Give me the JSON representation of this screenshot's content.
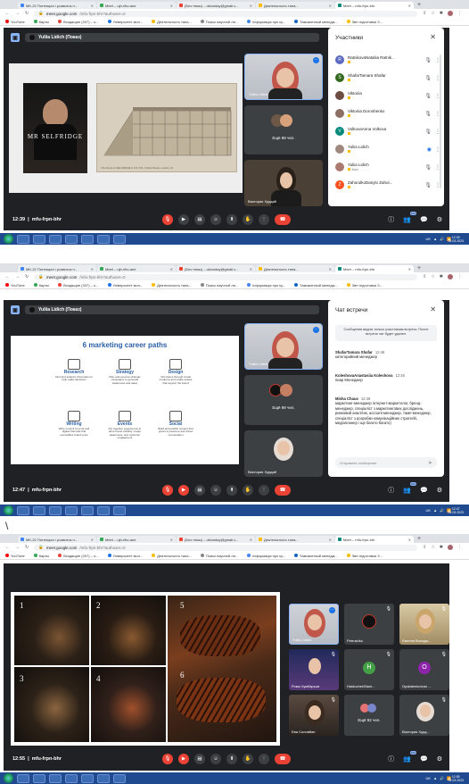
{
  "browser": {
    "tabs": [
      "MK-22 Потенціал і розвиток п...",
      "Meet – ujh-rfkv-ane",
      "(Без темы) – oklunday@gmail.c...",
      "Деятельность тана...",
      "Meet – mfu-frpn-bhr"
    ],
    "url_host": "meet.google.com",
    "url_path": "/mfu-frpn-bhr?authuser=0",
    "bookmarks": [
      "YouTube",
      "Карты",
      "Входящие (337) – о...",
      "Університет мол...",
      "Деятельность тана...",
      "Поиск научной ли...",
      "Інформація про ку...",
      "Таможенный менедж...",
      "Звіт підготовки З..."
    ]
  },
  "shot1": {
    "presenter": "Yuliia Lidich (Показ)",
    "slide_poster_title": "MR SELFRIDGE",
    "slide_postcard_caption": "The House of SELFRIDGE & CO LTD., Oxford Street, London, W.",
    "tile_main_name": "Yuliia Lidich",
    "tile_more": "Ещё 98 чел.",
    "tile_bottom_name": "Виктория Хурдай",
    "time": "12:39",
    "meeting_code": "mfu-frpn-bhr",
    "participants_count": "101",
    "panel_title": "Участники",
    "participants": [
      {
        "name": "RatnikovaNataliia Ratnik...",
        "initial": "R",
        "color": "#5c6bc0"
      },
      {
        "name": "ShafarTamara Shafar",
        "initial": "S",
        "color": "#33691e"
      },
      {
        "name": "Viktoriia",
        "initial": "",
        "color": "#6d4c41"
      },
      {
        "name": "Viktoriia Doroshenko",
        "initial": "",
        "color": "#8d6e63"
      },
      {
        "name": "VolkovaAnna Volkova",
        "initial": "V",
        "color": "#00897b"
      },
      {
        "name": "Yuliia Lidich",
        "initial": "",
        "color": "#a1887f"
      },
      {
        "name": "Yuliia Lidich",
        "initial": "",
        "color": "#ad7a72"
      },
      {
        "name": "ZahorulkoDanylo Zahor...",
        "initial": "Z",
        "color": "#f4511e"
      }
    ],
    "you_label": "(вы)",
    "host_label": "Хост",
    "clock": "12:39\n05.03.2023"
  },
  "shot2": {
    "presenter": "Yuliia Lidich (Показ)",
    "slide_title": "6 marketing career paths",
    "careers": [
      {
        "title": "Research",
        "desc": "Find and analyze information to help make decisions"
      },
      {
        "title": "Strategy",
        "desc": "Plan and execute strategic campaigns to generate awareness and sales"
      },
      {
        "title": "Design",
        "desc": "Tell stories through visual mediums and create assets that support the brand"
      },
      {
        "title": "Writing",
        "desc": "Write content for print and digital channels that exemplifies brand voice"
      },
      {
        "title": "Events",
        "desc": "Put together experiences to drive brand visibility, create awareness, and customer engagement"
      },
      {
        "title": "Social",
        "desc": "Build and publish content that grows a presence and drives conversation"
      }
    ],
    "tile_main_name": "Yuliia Lidich",
    "tile_more": "Ещё 98 чел.",
    "tile_bottom_name": "Виктория Хурдай",
    "time": "12:47",
    "meeting_code": "mfu-frpn-bhr",
    "participants_count": "101",
    "panel_title": "Чат встречи",
    "chat_notice": "Сообщения видны только участникам встречи. После встречи чат будет удален.",
    "messages": [
      {
        "who": "ShafarTamara Shafar",
        "time": "12:46",
        "text": "категорийний менеджер"
      },
      {
        "who": "KoleshovaAnastasiia Koleshova",
        "time": "12:46",
        "text": "пиар Менеджер"
      },
      {
        "who": "Misha Chaus",
        "time": "12:46",
        "text": "маркетинг-менеджер інтернет-маркетолог, бренд-менеджер, спеціаліст з маркетингових досліджень, ринковий аналітик, account-менеджер, тамп-менеджер, спеціаліст з розробки комунікаційних стратегій, медіапланер і ще багато-багато)"
      }
    ],
    "chat_placeholder": "Отправьте сообщение",
    "clock": "12:47\n05.03.2023"
  },
  "shot3": {
    "food_numbers": [
      "1",
      "2",
      "3",
      "4",
      "5",
      "6"
    ],
    "tiles": [
      {
        "name": "Yuliia Lidich",
        "type": "photo"
      },
      {
        "name": "Petrushko",
        "type": "logo"
      },
      {
        "name": "Євгенія Володи...",
        "type": "photo"
      },
      {
        "name": "Рома Чумбарьов",
        "type": "photo"
      },
      {
        "name": "HaiduchekStani...",
        "type": "letter",
        "initial": "H",
        "color": "#43a047"
      },
      {
        "name": "OpalatenkoIvan ...",
        "type": "letter",
        "initial": "O",
        "color": "#8e24aa"
      },
      {
        "name": "Ева Соловйан",
        "type": "photo"
      },
      {
        "name": "Ещё 92 чел.",
        "type": "more"
      },
      {
        "name": "Виктория Хурд...",
        "type": "photo"
      }
    ],
    "time": "12:55",
    "meeting_code": "mfu-frpn-bhr",
    "participants_count": "101",
    "clock": "12:55\n05.03.2023"
  },
  "separator_mark": "\\",
  "colors": {
    "meet_bg": "#202124",
    "accent": "#8ab4f8",
    "end_call": "#ea4335"
  }
}
